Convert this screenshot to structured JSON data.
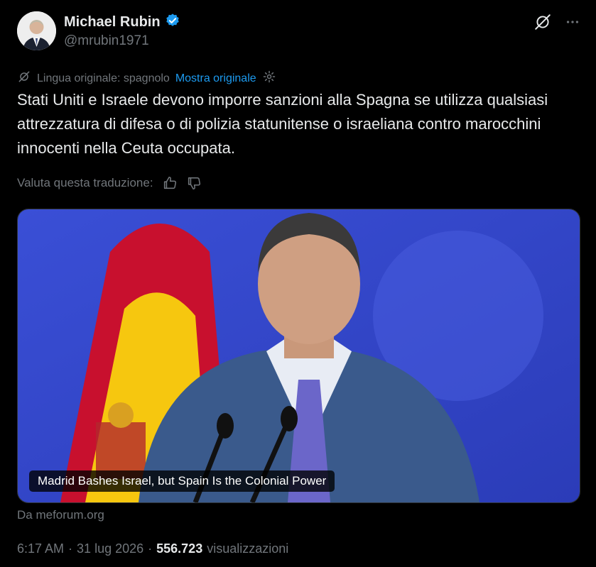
{
  "author": {
    "name": "Michael Rubin",
    "handle": "@mrubin1971",
    "verified": true
  },
  "translation": {
    "original_language_label": "Lingua originale: spagnolo",
    "show_original": "Mostra originale",
    "rate_label": "Valuta questa traduzione:"
  },
  "tweet": {
    "text": "Stati Uniti e Israele devono imporre sanzioni alla Spagna se utilizza qualsiasi attrezzatura di difesa o di polizia statunitense o israeliana contro marocchini innocenti nella Ceuta occupata."
  },
  "card": {
    "title": "Madrid Bashes Israel, but Spain Is the Colonial Power",
    "source": "Da meforum.org"
  },
  "meta": {
    "time": "6:17 AM",
    "sep1": "·",
    "date": "31 lug 2026",
    "sep2": "·",
    "views": "556.723",
    "views_label": "visualizzazioni"
  },
  "colors": {
    "background": "#000000",
    "text": "#e7e9ea",
    "muted": "#71767b",
    "link": "#1d9bf0",
    "verified": "#1d9bf0"
  },
  "icons": [
    "grok-icon",
    "more-icon",
    "translate-icon",
    "settings-icon",
    "thumbs-up-icon",
    "thumbs-down-icon",
    "verified-badge-icon"
  ]
}
